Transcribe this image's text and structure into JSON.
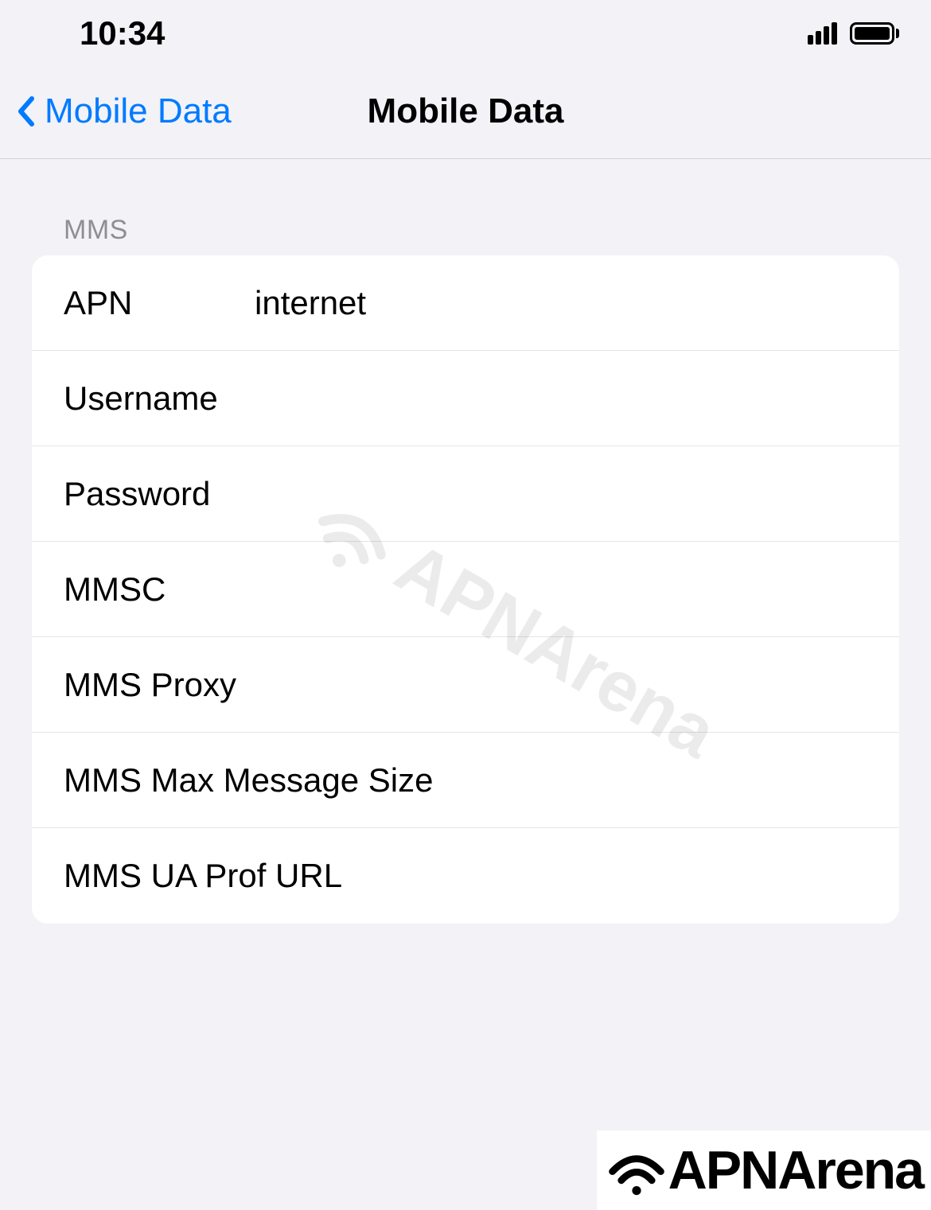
{
  "statusBar": {
    "time": "10:34"
  },
  "navBar": {
    "backLabel": "Mobile Data",
    "title": "Mobile Data"
  },
  "sectionHeader": "MMS",
  "fields": {
    "apn": {
      "label": "APN",
      "value": "internet"
    },
    "username": {
      "label": "Username",
      "value": ""
    },
    "password": {
      "label": "Password",
      "value": ""
    },
    "mmsc": {
      "label": "MMSC",
      "value": ""
    },
    "mmsProxy": {
      "label": "MMS Proxy",
      "value": ""
    },
    "mmsMaxSize": {
      "label": "MMS Max Message Size",
      "value": ""
    },
    "mmsUaProf": {
      "label": "MMS UA Prof URL",
      "value": ""
    }
  },
  "watermark": "APNArena",
  "brand": "APNArena"
}
